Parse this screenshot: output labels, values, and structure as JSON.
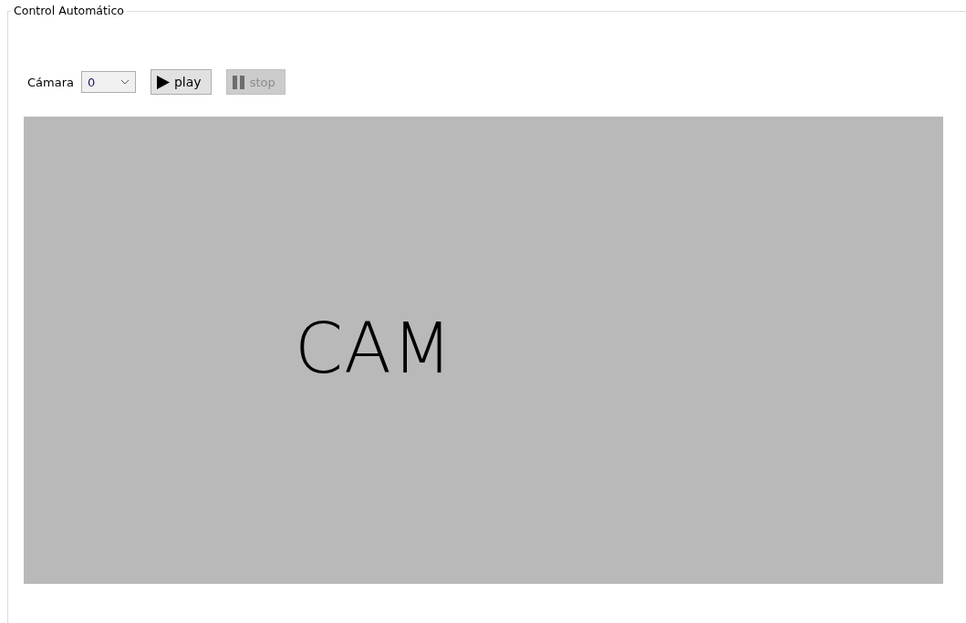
{
  "group": {
    "title": "Control Automático"
  },
  "toolbar": {
    "camera_label": "Cámara",
    "camera_select": {
      "value": "0"
    },
    "buttons": [
      {
        "kind": "play",
        "label": "play",
        "disabled": false
      },
      {
        "kind": "stop",
        "label": "stop",
        "disabled": true
      }
    ]
  },
  "preview": {
    "text": "CAM"
  }
}
